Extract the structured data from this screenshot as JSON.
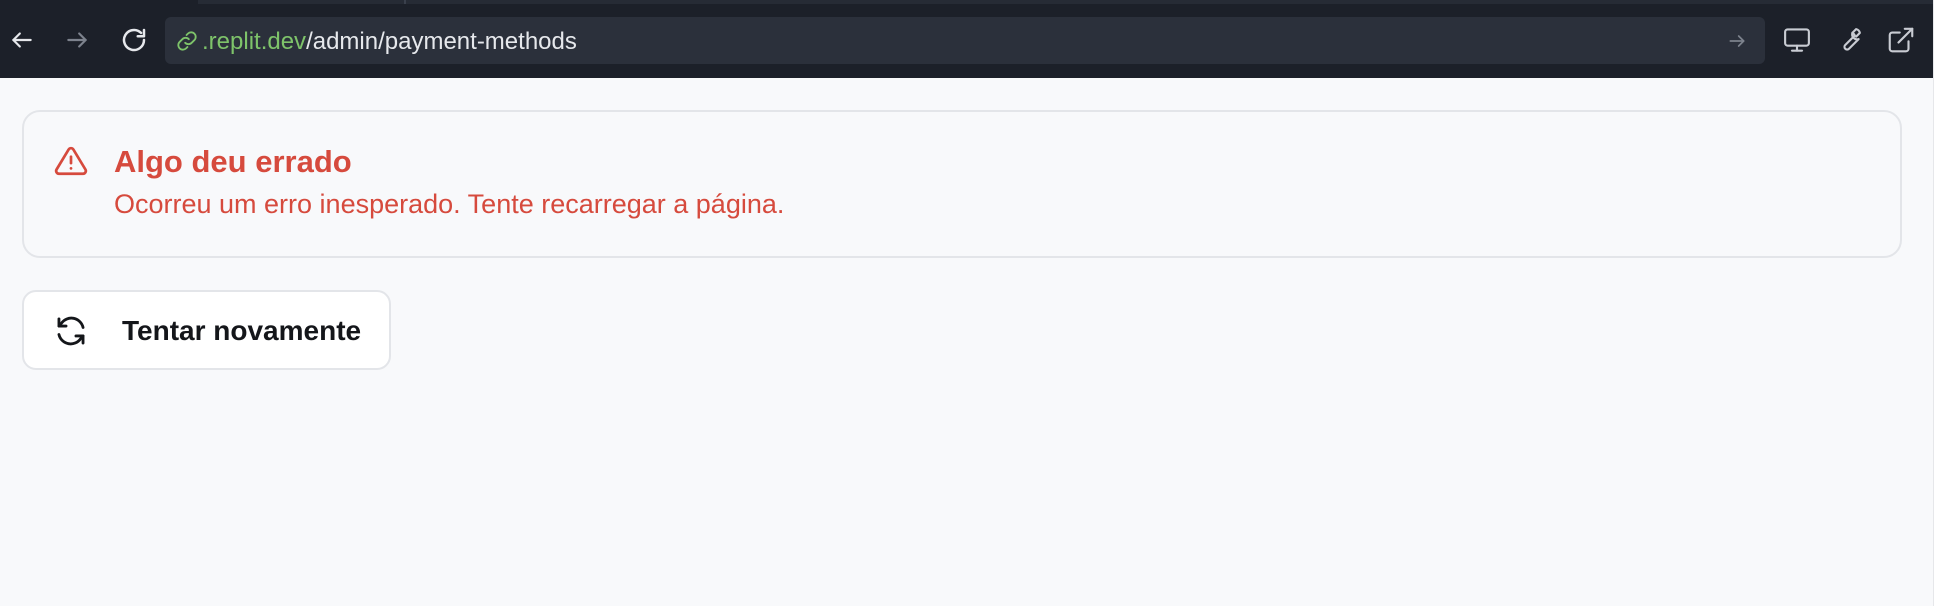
{
  "browser": {
    "url_domain": ".replit.dev",
    "url_path": "/admin/payment-methods",
    "icons": {
      "back": "arrow-left-icon",
      "forward": "arrow-right-icon",
      "reload": "reload-icon",
      "link": "link-icon",
      "go": "arrow-right-icon",
      "device": "monitor-icon",
      "devtools": "wrench-icon",
      "open_external": "external-link-icon"
    }
  },
  "error_alert": {
    "title": "Algo deu errado",
    "description": "Ocorreu um erro inesperado. Tente recarregar a página.",
    "color": "#d64a3d",
    "icon": "warning-triangle-icon"
  },
  "retry_button": {
    "label": "Tentar novamente",
    "icon": "refresh-icon"
  }
}
